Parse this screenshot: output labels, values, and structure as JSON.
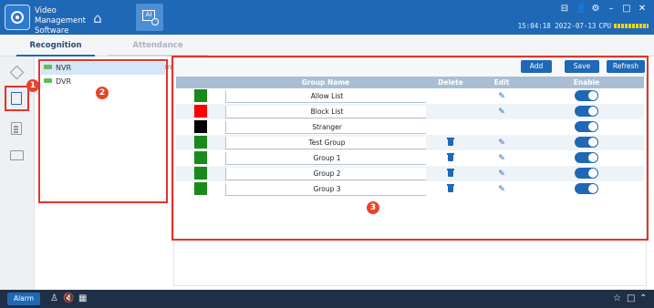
{
  "app": {
    "title": "Video Management Software"
  },
  "window": {
    "controls": [
      "⊟",
      "👤",
      "⚙",
      "–",
      "□",
      "✕"
    ]
  },
  "status": {
    "time": "15:04:18 2022-07-13",
    "cpu_label": "CPU"
  },
  "tabs": [
    {
      "label": "Recognition",
      "active": true
    },
    {
      "label": "Attendance management",
      "active": false
    }
  ],
  "annotations": {
    "marker1": "1",
    "marker2": "2",
    "marker3": "3"
  },
  "device_tree": [
    {
      "label": "NVR",
      "selected": true
    },
    {
      "label": "DVR",
      "selected": false
    }
  ],
  "toolbar": {
    "add_label": "Add",
    "save_label": "Save",
    "refresh_label": "Refresh"
  },
  "table": {
    "headers": [
      "",
      "Group Name",
      "Delete",
      "Edit",
      "Enable"
    ],
    "rows": [
      {
        "color": "#1a8a1a",
        "name": "Allow List",
        "deletable": false,
        "editable": true,
        "enabled": true
      },
      {
        "color": "#ff0000",
        "name": "Block List",
        "deletable": false,
        "editable": true,
        "enabled": true
      },
      {
        "color": "#000000",
        "name": "Stranger",
        "deletable": false,
        "editable": false,
        "enabled": true
      },
      {
        "color": "#1a8a1a",
        "name": "Test Group",
        "deletable": true,
        "editable": true,
        "enabled": true
      },
      {
        "color": "#1a8a1a",
        "name": "Group 1",
        "deletable": true,
        "editable": true,
        "enabled": true
      },
      {
        "color": "#1a8a1a",
        "name": "Group 2",
        "deletable": true,
        "editable": true,
        "enabled": true
      },
      {
        "color": "#1a8a1a",
        "name": "Group 3",
        "deletable": true,
        "editable": true,
        "enabled": true
      }
    ]
  },
  "statusbar": {
    "alarm_label": "Alarm"
  },
  "colors": {
    "accent": "#1f68b5",
    "annotation": "#e5332a"
  }
}
